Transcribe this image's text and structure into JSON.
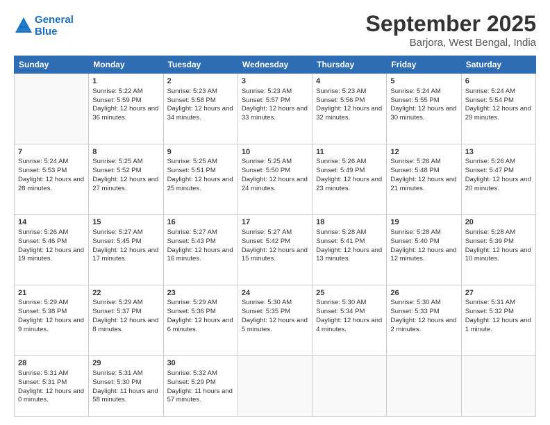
{
  "logo": {
    "line1": "General",
    "line2": "Blue"
  },
  "header": {
    "month": "September 2025",
    "location": "Barjora, West Bengal, India"
  },
  "weekdays": [
    "Sunday",
    "Monday",
    "Tuesday",
    "Wednesday",
    "Thursday",
    "Friday",
    "Saturday"
  ],
  "weeks": [
    [
      {
        "day": "",
        "sunrise": "",
        "sunset": "",
        "daylight": "",
        "empty": true
      },
      {
        "day": "1",
        "sunrise": "Sunrise: 5:22 AM",
        "sunset": "Sunset: 5:59 PM",
        "daylight": "Daylight: 12 hours and 36 minutes."
      },
      {
        "day": "2",
        "sunrise": "Sunrise: 5:23 AM",
        "sunset": "Sunset: 5:58 PM",
        "daylight": "Daylight: 12 hours and 34 minutes."
      },
      {
        "day": "3",
        "sunrise": "Sunrise: 5:23 AM",
        "sunset": "Sunset: 5:57 PM",
        "daylight": "Daylight: 12 hours and 33 minutes."
      },
      {
        "day": "4",
        "sunrise": "Sunrise: 5:23 AM",
        "sunset": "Sunset: 5:56 PM",
        "daylight": "Daylight: 12 hours and 32 minutes."
      },
      {
        "day": "5",
        "sunrise": "Sunrise: 5:24 AM",
        "sunset": "Sunset: 5:55 PM",
        "daylight": "Daylight: 12 hours and 30 minutes."
      },
      {
        "day": "6",
        "sunrise": "Sunrise: 5:24 AM",
        "sunset": "Sunset: 5:54 PM",
        "daylight": "Daylight: 12 hours and 29 minutes."
      }
    ],
    [
      {
        "day": "7",
        "sunrise": "Sunrise: 5:24 AM",
        "sunset": "Sunset: 5:53 PM",
        "daylight": "Daylight: 12 hours and 28 minutes."
      },
      {
        "day": "8",
        "sunrise": "Sunrise: 5:25 AM",
        "sunset": "Sunset: 5:52 PM",
        "daylight": "Daylight: 12 hours and 27 minutes."
      },
      {
        "day": "9",
        "sunrise": "Sunrise: 5:25 AM",
        "sunset": "Sunset: 5:51 PM",
        "daylight": "Daylight: 12 hours and 25 minutes."
      },
      {
        "day": "10",
        "sunrise": "Sunrise: 5:25 AM",
        "sunset": "Sunset: 5:50 PM",
        "daylight": "Daylight: 12 hours and 24 minutes."
      },
      {
        "day": "11",
        "sunrise": "Sunrise: 5:26 AM",
        "sunset": "Sunset: 5:49 PM",
        "daylight": "Daylight: 12 hours and 23 minutes."
      },
      {
        "day": "12",
        "sunrise": "Sunrise: 5:26 AM",
        "sunset": "Sunset: 5:48 PM",
        "daylight": "Daylight: 12 hours and 21 minutes."
      },
      {
        "day": "13",
        "sunrise": "Sunrise: 5:26 AM",
        "sunset": "Sunset: 5:47 PM",
        "daylight": "Daylight: 12 hours and 20 minutes."
      }
    ],
    [
      {
        "day": "14",
        "sunrise": "Sunrise: 5:26 AM",
        "sunset": "Sunset: 5:46 PM",
        "daylight": "Daylight: 12 hours and 19 minutes."
      },
      {
        "day": "15",
        "sunrise": "Sunrise: 5:27 AM",
        "sunset": "Sunset: 5:45 PM",
        "daylight": "Daylight: 12 hours and 17 minutes."
      },
      {
        "day": "16",
        "sunrise": "Sunrise: 5:27 AM",
        "sunset": "Sunset: 5:43 PM",
        "daylight": "Daylight: 12 hours and 16 minutes."
      },
      {
        "day": "17",
        "sunrise": "Sunrise: 5:27 AM",
        "sunset": "Sunset: 5:42 PM",
        "daylight": "Daylight: 12 hours and 15 minutes."
      },
      {
        "day": "18",
        "sunrise": "Sunrise: 5:28 AM",
        "sunset": "Sunset: 5:41 PM",
        "daylight": "Daylight: 12 hours and 13 minutes."
      },
      {
        "day": "19",
        "sunrise": "Sunrise: 5:28 AM",
        "sunset": "Sunset: 5:40 PM",
        "daylight": "Daylight: 12 hours and 12 minutes."
      },
      {
        "day": "20",
        "sunrise": "Sunrise: 5:28 AM",
        "sunset": "Sunset: 5:39 PM",
        "daylight": "Daylight: 12 hours and 10 minutes."
      }
    ],
    [
      {
        "day": "21",
        "sunrise": "Sunrise: 5:29 AM",
        "sunset": "Sunset: 5:38 PM",
        "daylight": "Daylight: 12 hours and 9 minutes."
      },
      {
        "day": "22",
        "sunrise": "Sunrise: 5:29 AM",
        "sunset": "Sunset: 5:37 PM",
        "daylight": "Daylight: 12 hours and 8 minutes."
      },
      {
        "day": "23",
        "sunrise": "Sunrise: 5:29 AM",
        "sunset": "Sunset: 5:36 PM",
        "daylight": "Daylight: 12 hours and 6 minutes."
      },
      {
        "day": "24",
        "sunrise": "Sunrise: 5:30 AM",
        "sunset": "Sunset: 5:35 PM",
        "daylight": "Daylight: 12 hours and 5 minutes."
      },
      {
        "day": "25",
        "sunrise": "Sunrise: 5:30 AM",
        "sunset": "Sunset: 5:34 PM",
        "daylight": "Daylight: 12 hours and 4 minutes."
      },
      {
        "day": "26",
        "sunrise": "Sunrise: 5:30 AM",
        "sunset": "Sunset: 5:33 PM",
        "daylight": "Daylight: 12 hours and 2 minutes."
      },
      {
        "day": "27",
        "sunrise": "Sunrise: 5:31 AM",
        "sunset": "Sunset: 5:32 PM",
        "daylight": "Daylight: 12 hours and 1 minute."
      }
    ],
    [
      {
        "day": "28",
        "sunrise": "Sunrise: 5:31 AM",
        "sunset": "Sunset: 5:31 PM",
        "daylight": "Daylight: 12 hours and 0 minutes."
      },
      {
        "day": "29",
        "sunrise": "Sunrise: 5:31 AM",
        "sunset": "Sunset: 5:30 PM",
        "daylight": "Daylight: 11 hours and 58 minutes."
      },
      {
        "day": "30",
        "sunrise": "Sunrise: 5:32 AM",
        "sunset": "Sunset: 5:29 PM",
        "daylight": "Daylight: 11 hours and 57 minutes."
      },
      {
        "day": "",
        "empty": true
      },
      {
        "day": "",
        "empty": true
      },
      {
        "day": "",
        "empty": true
      },
      {
        "day": "",
        "empty": true
      }
    ]
  ]
}
